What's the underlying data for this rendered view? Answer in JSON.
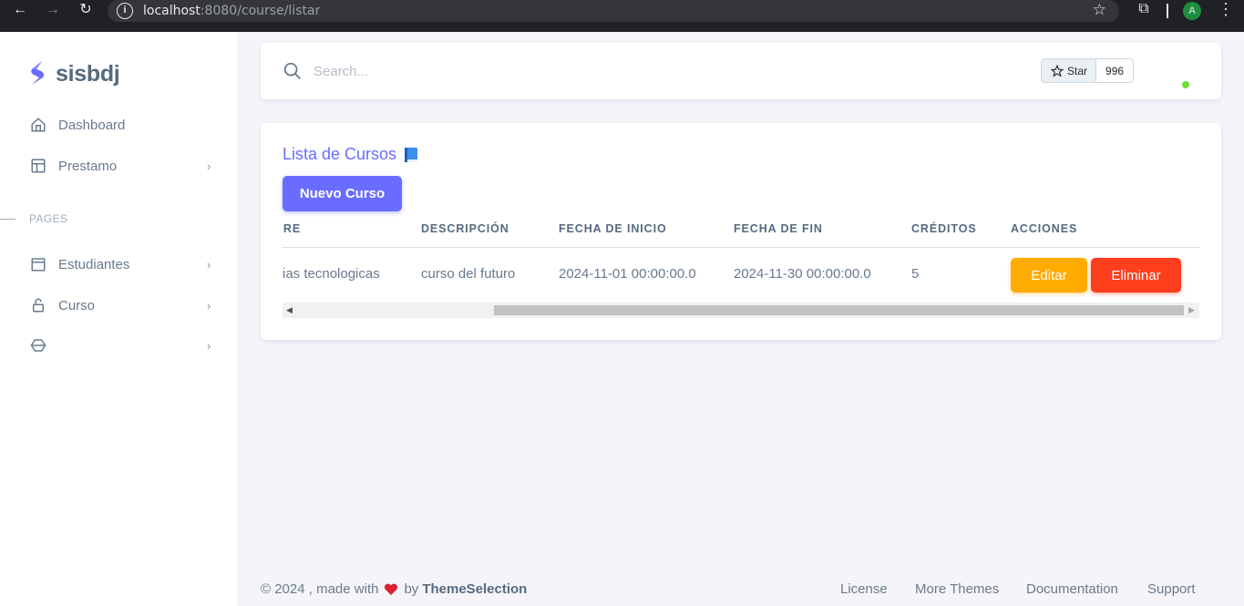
{
  "browser": {
    "url_host": "localhost",
    "url_rest": ":8080/course/listar",
    "profile_initial": "A"
  },
  "sidebar": {
    "app_name": "sisbdj",
    "brand_color": "#696cff",
    "items": [
      {
        "label": "Dashboard",
        "icon": "home-icon"
      },
      {
        "label": "Prestamo",
        "icon": "layout-icon"
      }
    ],
    "section_header": "PAGES",
    "page_items": [
      {
        "label": "Estudiantes",
        "icon": "browser-window-icon"
      },
      {
        "label": "Curso",
        "icon": "lock-open-icon"
      },
      {
        "label": "",
        "icon": "cube-icon"
      }
    ]
  },
  "navbar": {
    "search_placeholder": "Search...",
    "github_star_label": "Star",
    "github_star_count": "996",
    "status_color": "#71dd37"
  },
  "main": {
    "title": "Lista de Cursos",
    "new_button_label": "Nuevo Curso",
    "table": {
      "columns": [
        "BRE",
        "DESCRIPCIÓN",
        "FECHA DE INICIO",
        "FECHA DE FIN",
        "CRÉDITOS",
        "ACCIONES"
      ],
      "rows": [
        {
          "nombre": "ias tecnologicas",
          "descripcion": "curso del futuro",
          "fecha_inicio": "2024-11-01 00:00:00.0",
          "fecha_fin": "2024-11-30 00:00:00.0",
          "creditos": "5",
          "edit_label": "Editar",
          "delete_label": "Eliminar"
        }
      ]
    }
  },
  "footer": {
    "copyright": "© 2024 , made with",
    "by": "by",
    "brand": "ThemeSelection",
    "links": [
      "License",
      "More Themes",
      "Documentation",
      "Support"
    ]
  }
}
